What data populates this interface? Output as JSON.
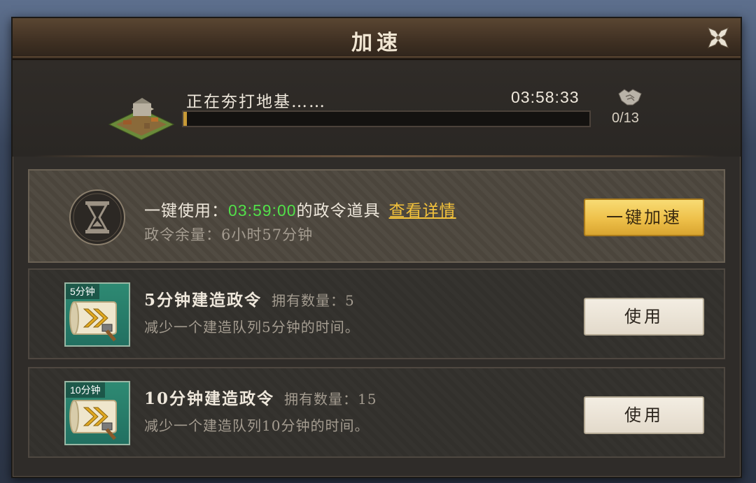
{
  "dialog": {
    "title": "加速",
    "close_icon": "close-x-icon"
  },
  "task": {
    "label": "正在夯打地基……",
    "time_remaining": "03:58:33",
    "progress": 0.008,
    "help_count": "0/13",
    "help_icon": "handshake-icon"
  },
  "one_click": {
    "prefix": "一键使用：",
    "duration": "03:59:00",
    "suffix": "的政令道具",
    "details_link": "查看详情",
    "remaining": "政令余量：6小时57分钟",
    "button_label": "一键加速",
    "icon": "hourglass-icon"
  },
  "items": [
    {
      "icon_label": "5分钟",
      "name": "5分钟建造政令",
      "owned": "拥有数量：5",
      "desc": "减少一个建造队列5分钟的时间。",
      "button": "使用"
    },
    {
      "icon_label": "10分钟",
      "name": "10分钟建造政令",
      "owned": "拥有数量：15",
      "desc": "减少一个建造队列10分钟的时间。",
      "button": "使用"
    }
  ],
  "colors": {
    "accent_gold": "#f3c23b",
    "time_green": "#52e04a",
    "progress_fill": "#c89a36"
  }
}
